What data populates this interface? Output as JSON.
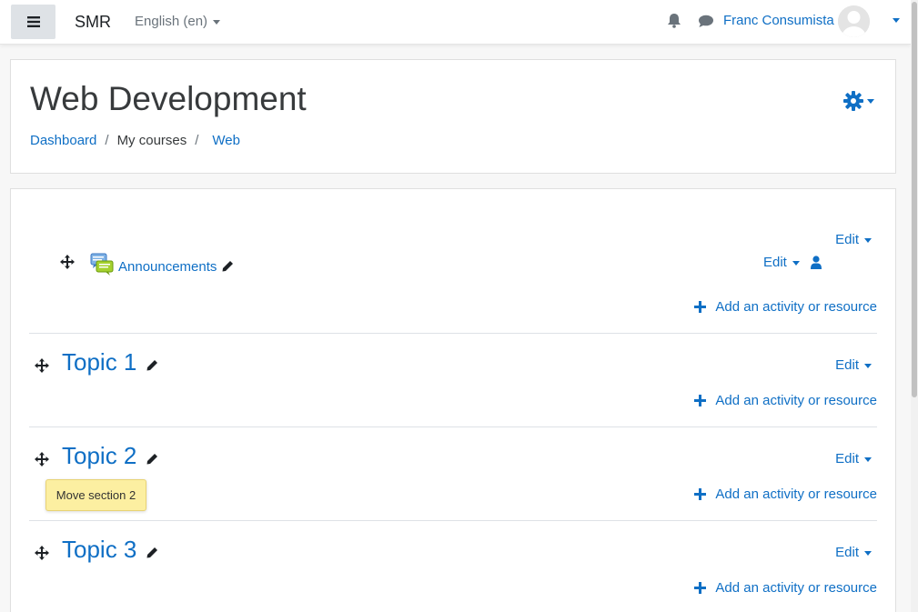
{
  "navbar": {
    "brand": "SMR",
    "language": "English (en)",
    "username": "Franc Consumista",
    "icons": [
      "menu-icon",
      "bell-icon",
      "chat-icon",
      "avatar"
    ]
  },
  "header": {
    "title": "Web Development",
    "breadcrumb": [
      {
        "label": "Dashboard"
      },
      {
        "label": "My courses"
      },
      {
        "label": "Web"
      }
    ]
  },
  "sections": {
    "general": {
      "edit_label": "Edit",
      "activity_name": "Announcements",
      "activity_edit_label": "Edit",
      "add_label": "Add an activity or resource"
    },
    "topics": [
      {
        "title": "Topic 1",
        "edit_label": "Edit",
        "add_label": "Add an activity or resource"
      },
      {
        "title": "Topic 2",
        "edit_label": "Edit",
        "add_label": "Add an activity or resource"
      },
      {
        "title": "Topic 3",
        "edit_label": "Edit",
        "add_label": "Add an activity or resource"
      }
    ]
  },
  "tooltip": {
    "text": "Move section 2"
  },
  "colors": {
    "accent": "#0f6fc5",
    "tooltip_bg": "#fcefa1",
    "navbar_bg": "#ffffff"
  }
}
